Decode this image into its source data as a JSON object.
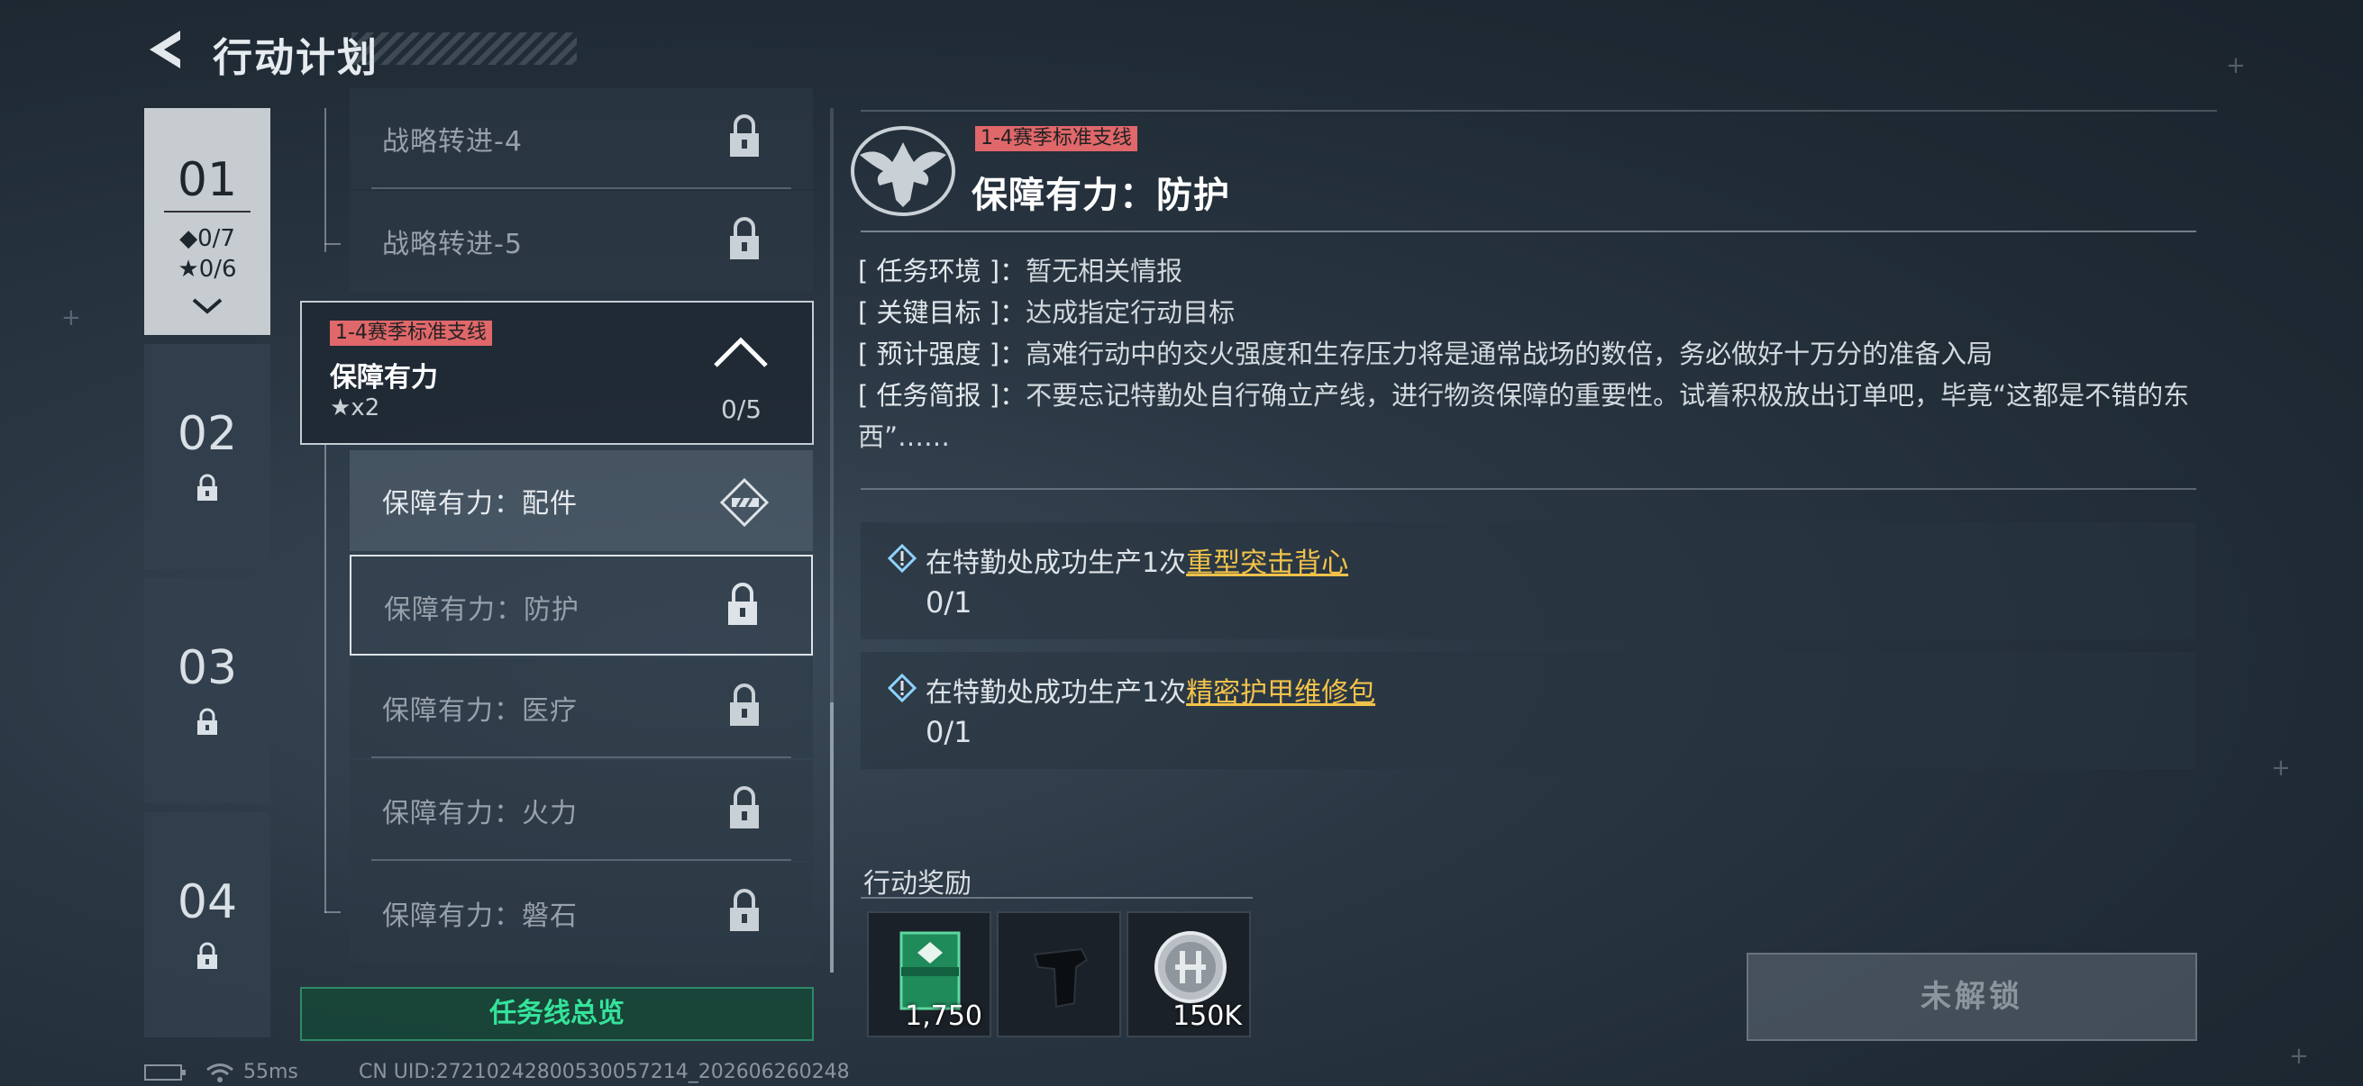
{
  "header": {
    "title": "行动计划"
  },
  "chapters": [
    {
      "number": "01",
      "diamond_progress": "◆0/7",
      "star_progress": "★0/6",
      "active": true
    },
    {
      "number": "02",
      "locked": true
    },
    {
      "number": "03",
      "locked": true
    },
    {
      "number": "04",
      "locked": true
    }
  ],
  "missions_above": [
    {
      "label": "战略转进-4",
      "locked": true
    },
    {
      "label": "战略转进-5",
      "locked": true
    }
  ],
  "mission_group": {
    "tag": "1-4赛季标准支线",
    "title": "保障有力",
    "reward": "★x2",
    "progress": "0/5"
  },
  "missions": [
    {
      "label": "保障有力：配件",
      "state": "available"
    },
    {
      "label": "保障有力：防护",
      "state": "selected"
    },
    {
      "label": "保障有力：医疗",
      "state": "locked"
    },
    {
      "label": "保障有力：火力",
      "state": "locked"
    },
    {
      "label": "保障有力：磐石",
      "state": "locked"
    }
  ],
  "overview_button": "任务线总览",
  "detail": {
    "tag": "1-4赛季标准支线",
    "title": "保障有力：防护",
    "environment_key": "[ 任务环境 ]：",
    "environment": "暂无相关情报",
    "target_key": "[ 关键目标 ]：",
    "target": "达成指定行动目标",
    "intensity_key": "[ 预计强度 ]：",
    "intensity": "高难行动中的交火强度和生存压力将是通常战场的数倍，务必做好十万分的准备入局",
    "brief_key": "[ 任务简报 ]：",
    "brief": "不要忘记特勤处自行确立产线，进行物资保障的重要性。试着积极放出订单吧，毕竟“这都是不错的东西”……"
  },
  "objectives": [
    {
      "prefix": "在特勤处成功生产1次",
      "item": "重型突击背心",
      "progress": "0/1"
    },
    {
      "prefix": "在特勤处成功生产1次",
      "item": "精密护甲维修包",
      "progress": "0/1"
    }
  ],
  "rewards": {
    "label": "行动奖励",
    "items": [
      {
        "icon": "green-crate-icon",
        "quantity": "1,750"
      },
      {
        "icon": "weapon-stock-icon",
        "quantity": ""
      },
      {
        "icon": "silver-coin-icon",
        "quantity": "150K"
      }
    ]
  },
  "unlock_button": "未解锁",
  "status": {
    "ping": "55ms",
    "uid": "CN UID:27210242800530057214_202606260248"
  },
  "colors": {
    "accent_green": "#35e29a",
    "tag_red": "#e0676a",
    "highlight_gold": "#f2c24a"
  }
}
